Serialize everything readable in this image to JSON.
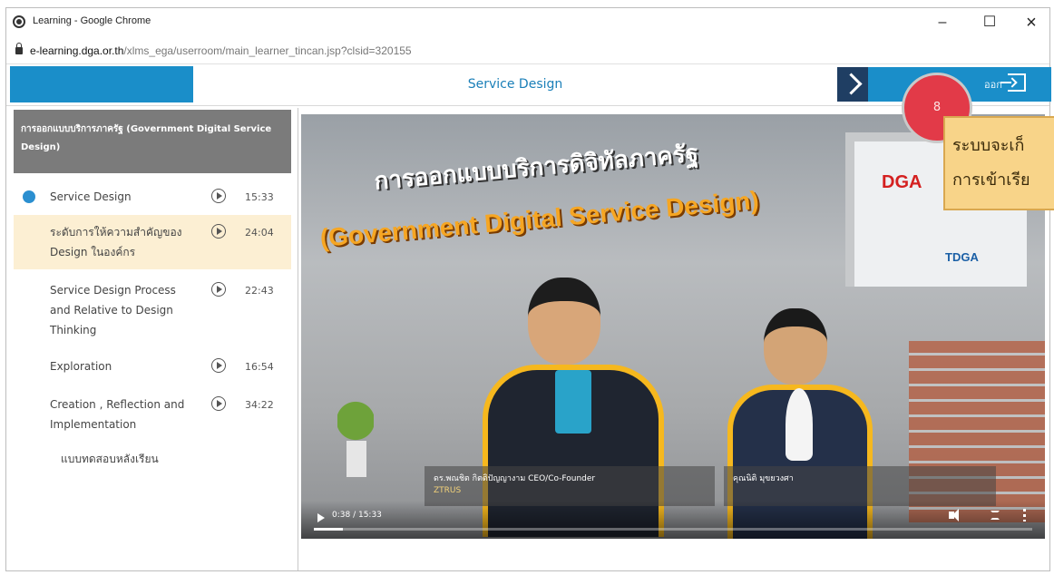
{
  "window": {
    "title": "Learning - Google Chrome",
    "minimize": "–",
    "maximize": "☐",
    "close": "×"
  },
  "address": {
    "host": "e-learning.dga.or.th",
    "path": "/xlms_ega/userroom/main_learner_tincan.jsp?clsid=320155"
  },
  "app": {
    "course_title": "Service Design",
    "exit_label": "ออก"
  },
  "sidebar": {
    "header": "การออกแบบบริการภาครัฐ (Government Digital Service Design)",
    "lessons": [
      {
        "label": "Service Design",
        "duration": "15:33"
      },
      {
        "label": "ระดับการให้ความสำคัญของ Design ในองค์กร",
        "duration": "24:04"
      },
      {
        "label": "Service Design Process and Relative to Design Thinking",
        "duration": "22:43"
      },
      {
        "label": "Exploration",
        "duration": "16:54"
      },
      {
        "label": "Creation , Reflection and Implementation",
        "duration": "34:22"
      },
      {
        "label": "แบบทดสอบหลังเรียน",
        "duration": ""
      }
    ]
  },
  "video": {
    "title_th": "การออกแบบบริการดิจิทัลภาครัฐ",
    "title_en": "(Government Digital Service Design)",
    "logo_dga": "DGA",
    "logo_tdga": "TDGA",
    "speaker1_name": "ดร.พณชิต กิตติปัญญางาม CEO/Co-Founder",
    "speaker1_role": "ZTRUS",
    "speaker2_name": "คุณนิติ มุขยวงศา",
    "speaker2_role": "",
    "time": "0:38 / 15:33",
    "progress": 0.04
  },
  "overlay": {
    "badge": "8",
    "tooltip_line1": "ระบบจะเก็",
    "tooltip_line2": "การเข้าเรีย"
  }
}
